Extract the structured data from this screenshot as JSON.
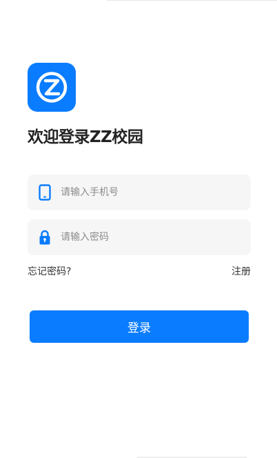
{
  "brand": {
    "logo_icon": "zz-campus-logo-icon",
    "logo_color": "#0a7cff"
  },
  "title": "欢迎登录ZZ校园",
  "phone_field": {
    "icon": "phone-icon",
    "placeholder": "请输入手机号",
    "value": ""
  },
  "password_field": {
    "icon": "lock-icon",
    "placeholder": "请输入密码",
    "value": ""
  },
  "links": {
    "forgot_password": "忘记密码?",
    "register": "注册"
  },
  "login_button": {
    "label": "登录"
  },
  "colors": {
    "accent": "#0a7cff",
    "field_bg": "#f6f6f6",
    "text": "#222222",
    "placeholder": "#8c8c8c"
  }
}
